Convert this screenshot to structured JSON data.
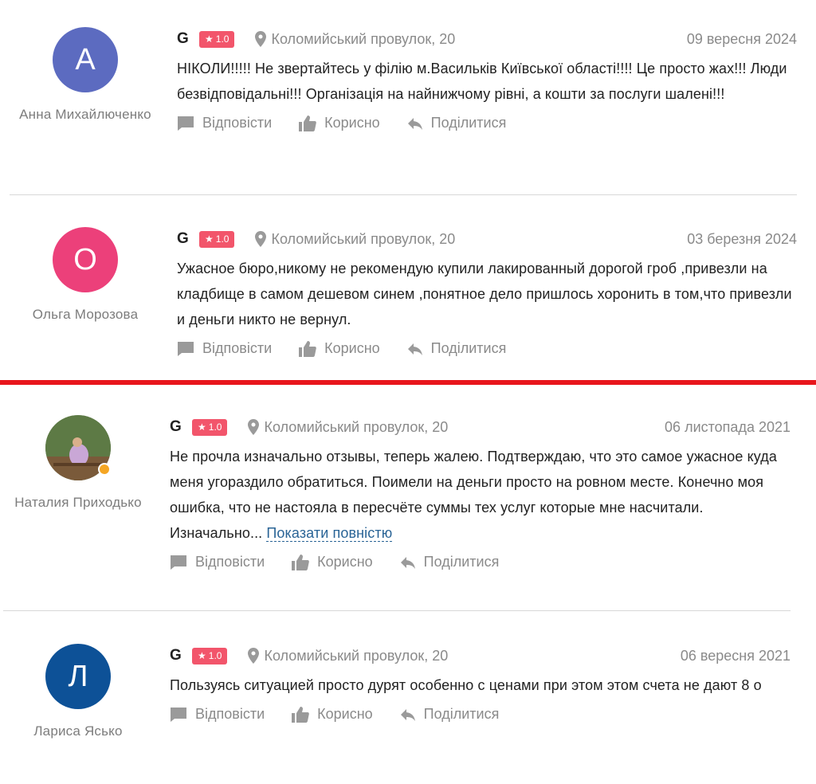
{
  "colors": {
    "badge": "#f2556b",
    "link": "#2a6496",
    "separator": "#e8161c"
  },
  "labels": {
    "reply": "Відповісти",
    "useful": "Корисно",
    "share": "Поділитися"
  },
  "reviews": [
    {
      "author": "Анна Михайлюченко",
      "avatar_letter": "А",
      "avatar_color": "#5c6bc0",
      "source": "G",
      "rating": "1.0",
      "location": "Коломийський провулок, 20",
      "date": "09 вересня 2024",
      "text": "НІКОЛИ!!!!! Не звертайтесь у філію м.Васильків Київської області!!!! Це просто жах!!! Люди безвідповідальні!!! Організація на найнижчому рівні, а кошти за послуги шалені!!!"
    },
    {
      "author": "Ольга Морозова",
      "avatar_letter": "О",
      "avatar_color": "#ec407a",
      "source": "G",
      "rating": "1.0",
      "location": "Коломийський провулок, 20",
      "date": "03 березня 2024",
      "text": "Ужасное бюро,никому не рекомендую купили лакированный дорогой гроб ,привезли на кладбище в самом дешевом синем ,понятное дело пришлось хоронить в том,что привезли и деньги никто не вернул."
    },
    {
      "author": "Наталия Приходько",
      "avatar_letter": "",
      "avatar_color": "#4e6b3a",
      "source": "G",
      "rating": "1.0",
      "location": "Коломийський провулок, 20",
      "date": "06 листопада 2021",
      "text": "Не прочла изначально отзывы, теперь жалею. Подтверждаю, что это самое ужасное куда меня угораздило обратиться. Поимели на деньги просто на ровном месте. Конечно моя ошибка, что не настояла в пересчёте суммы тех услуг которые мне насчитали. Изначально...",
      "more_label": "Показати повністю"
    },
    {
      "author": "Лариса Ясько",
      "avatar_letter": "Л",
      "avatar_color": "#0d5197",
      "source": "G",
      "rating": "1.0",
      "location": "Коломийський провулок, 20",
      "date": "06 вересня 2021",
      "text": "Пользуясь ситуацией просто дурят особенно с ценами при этом этом счета не дают 8 о"
    }
  ]
}
